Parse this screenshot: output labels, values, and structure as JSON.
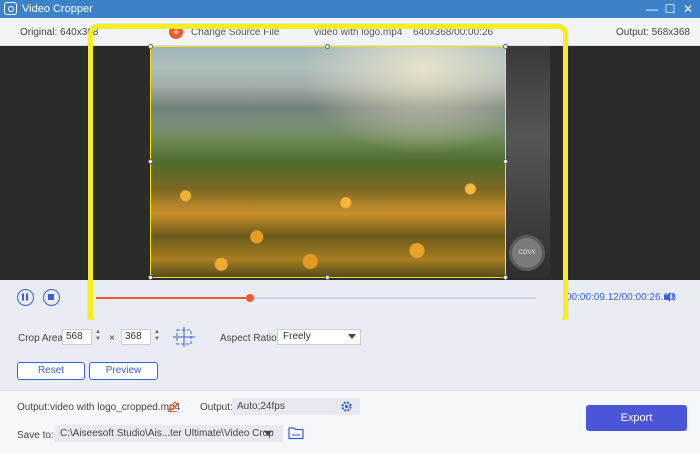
{
  "window": {
    "title": "Video Cropper",
    "minimize_label": "—",
    "maximize_label": "☐",
    "close_label": "✕"
  },
  "info": {
    "original_label": "Original: 640x368",
    "source_button_label": "Change Source File",
    "file_name": "video with logo.mp4",
    "file_meta": "640x368/00:00:26",
    "output_label": "Output: 568x368"
  },
  "preview": {
    "watermark_text": "COVX"
  },
  "playback": {
    "progress_fraction": 0.35,
    "time": "00:00:09.12/00:00:26.10"
  },
  "crop": {
    "area_label": "Crop Area:",
    "width": "568",
    "height": "368",
    "times": "×",
    "aspect_label": "Aspect Ratio:",
    "aspect_value": "Freely",
    "reset_label": "Reset",
    "preview_label": "Preview"
  },
  "output": {
    "label": "Output:",
    "file_name": "video with logo_cropped.mp4",
    "format_label": "Output:",
    "format_value": "Auto;24fps",
    "save_label": "Save to:",
    "save_path": "C:\\Aiseesoft Studio\\Ais...ter Ultimate\\Video Crop",
    "export_label": "Export"
  },
  "colors": {
    "accent": "#4a55d8",
    "highlight": "#f7ee21",
    "progress": "#f05a28",
    "titlebar": "#3b82c8"
  }
}
